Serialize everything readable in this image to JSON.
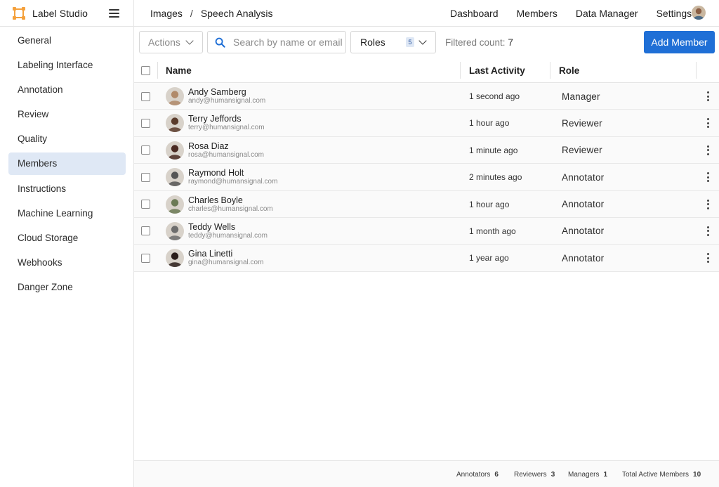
{
  "app": {
    "name": "Label Studio",
    "accent": "#f5a13c"
  },
  "breadcrumb": {
    "items": [
      "Images",
      "Speech Analysis"
    ],
    "separator": "/"
  },
  "topnav": {
    "items": [
      "Dashboard",
      "Members",
      "Data Manager",
      "Settings"
    ]
  },
  "sidebar": {
    "items": [
      {
        "label": "General"
      },
      {
        "label": "Labeling Interface"
      },
      {
        "label": "Annotation"
      },
      {
        "label": "Review"
      },
      {
        "label": "Quality"
      },
      {
        "label": "Members",
        "active": true
      },
      {
        "label": "Instructions"
      },
      {
        "label": "Machine Learning"
      },
      {
        "label": "Cloud Storage"
      },
      {
        "label": "Webhooks"
      },
      {
        "label": "Danger Zone"
      }
    ]
  },
  "toolbar": {
    "actions_label": "Actions",
    "search_placeholder": "Search by name or email",
    "roles_label": "Roles",
    "roles_count": "5",
    "filtered_label": "Filtered count:",
    "filtered_count": "7",
    "add_member_label": "Add Member",
    "primary_color": "#1f6fd6"
  },
  "table": {
    "columns": {
      "name": "Name",
      "last_activity": "Last Activity",
      "role": "Role"
    },
    "rows": [
      {
        "name": "Andy Samberg",
        "email": "andy@humansignal.com",
        "last_activity": "1 second ago",
        "role": "Manager",
        "avatar_color": "#b08a6a"
      },
      {
        "name": "Terry Jeffords",
        "email": "terry@humansignal.com",
        "last_activity": "1 hour ago",
        "role": "Reviewer",
        "avatar_color": "#5a3b2b"
      },
      {
        "name": "Rosa Diaz",
        "email": "rosa@humansignal.com",
        "last_activity": "1 minute ago",
        "role": "Reviewer",
        "avatar_color": "#4a2a22"
      },
      {
        "name": "Raymond Holt",
        "email": "raymond@humansignal.com",
        "last_activity": "2 minutes ago",
        "role": "Annotator",
        "avatar_color": "#555555"
      },
      {
        "name": "Charles Boyle",
        "email": "charles@humansignal.com",
        "last_activity": "1 hour ago",
        "role": "Annotator",
        "avatar_color": "#6b7a55"
      },
      {
        "name": "Teddy Wells",
        "email": "teddy@humansignal.com",
        "last_activity": "1 month ago",
        "role": "Annotator",
        "avatar_color": "#6d6d6d"
      },
      {
        "name": "Gina Linetti",
        "email": "gina@humansignal.com",
        "last_activity": "1 year ago",
        "role": "Annotator",
        "avatar_color": "#2a1d1a"
      }
    ]
  },
  "footer": {
    "annotators_label": "Annotators",
    "annotators": "6",
    "reviewers_label": "Reviewers",
    "reviewers": "3",
    "managers_label": "Managers",
    "managers": "1",
    "total_label": "Total Active Members",
    "total": "10"
  }
}
